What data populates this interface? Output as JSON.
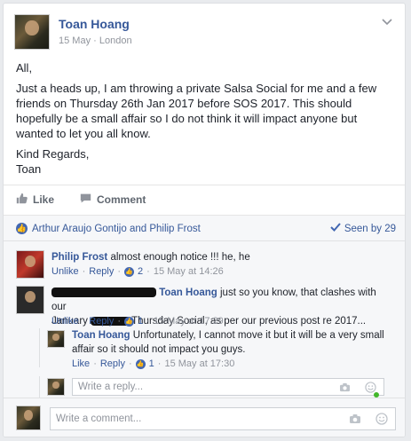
{
  "post": {
    "author": "Toan Hoang",
    "date": "15 May",
    "separator": "·",
    "location": "London",
    "paragraphs": [
      "All,",
      "Just a heads up, I am throwing a private Salsa Social for me and a few friends on Thursday 26th Jan 2017 before SOS 2017. This should hopefully be a small affair so I do not think it will impact anyone but wanted to let you all know.",
      "Kind Regards,",
      "Toan"
    ]
  },
  "actions": {
    "like": "Like",
    "comment": "Comment"
  },
  "reactions": {
    "names": "Arthur Araujo Gontijo and Philip Frost",
    "seen": "Seen by 29"
  },
  "comments": [
    {
      "name": "Philip Frost",
      "text": "almost enough notice !!! he, he",
      "unlike": "Unlike",
      "reply": "Reply",
      "sep": "·",
      "likes": "2",
      "time": "15 May at 14:26"
    },
    {
      "name_mention": "Toan Hoang",
      "text_a": "just so you know, that clashes with our",
      "text_b1": "January",
      "text_b2": "Thursday Social, as per our previous post re 2017...",
      "unlike": "Unlike",
      "reply": "Reply",
      "sep": "·",
      "likes": "1",
      "time": "15 May at 17:29"
    }
  ],
  "reply": {
    "name": "Toan Hoang",
    "text_a": "Unfortunately, I cannot move it but it will be a very small",
    "text_b": "affair so it should not impact you guys.",
    "like": "Like",
    "reply": "Reply",
    "sep": "·",
    "likes": "1",
    "time": "15 May at 17:30",
    "placeholder": "Write a reply..."
  },
  "comment_box": {
    "placeholder": "Write a comment..."
  },
  "icons": [
    "chevron-down-icon",
    "like-icon",
    "comment-icon",
    "thumbs-up-icon",
    "checkmark-icon",
    "camera-icon",
    "emoji-icon"
  ],
  "colors": {
    "link": "#365899",
    "meta": "#90949c",
    "like_blue": "#4267b2",
    "online": "#42b72a"
  }
}
